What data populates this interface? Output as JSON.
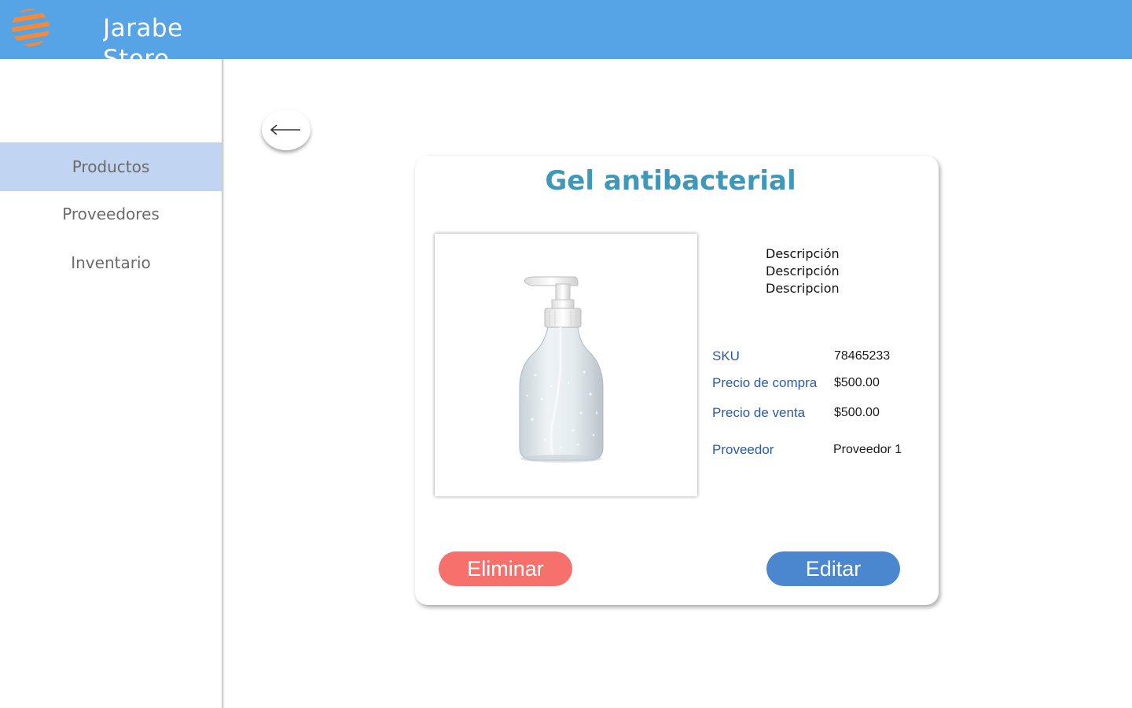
{
  "header": {
    "brand_name": "Jarabe Store",
    "logo_icon": "orange-striped-sphere-logo"
  },
  "sidebar": {
    "items": [
      {
        "label": "Productos",
        "active": true
      },
      {
        "label": "Proveedores",
        "active": false
      },
      {
        "label": "Inventario",
        "active": false
      }
    ]
  },
  "back_button": {
    "icon": "arrow-left-icon"
  },
  "product": {
    "title": "Gel antibacterial",
    "image_alt": "antibacterial gel pump bottle",
    "description_lines": [
      "Descripción",
      "Descripción",
      "Descripcion"
    ],
    "details": {
      "sku_label": "SKU",
      "sku_value": "78465233",
      "purchase_label": "Precio de compra",
      "purchase_value": "$500.00",
      "sale_label": "Precio de venta",
      "sale_value": "$500.00",
      "supplier_label": "Proveedor",
      "supplier_value": "Proveedor 1"
    }
  },
  "actions": {
    "delete_label": "Eliminar",
    "edit_label": "Editar"
  },
  "colors": {
    "header_bg": "#56a3e5",
    "sidebar_active_bg": "#c1d4f1",
    "title": "#3f98b8",
    "label": "#2b5aa6",
    "delete": "#f6706c",
    "edit": "#4a87cf",
    "logo": "#f08a3c"
  }
}
